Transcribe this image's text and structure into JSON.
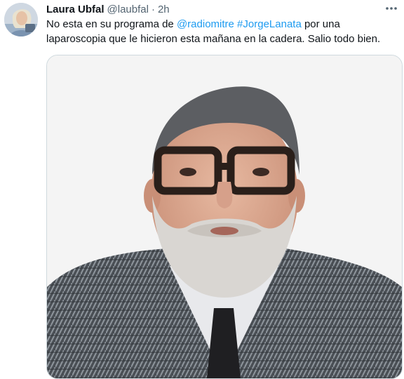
{
  "tweet": {
    "author": {
      "name": "Laura Ubfal",
      "handle": "@laubfal"
    },
    "separator": "·",
    "time": "2h",
    "more_icon": "more-horizontal-icon",
    "text_parts": [
      {
        "text": "No esta en su programa de ",
        "type": "text"
      },
      {
        "text": "@radiomitre",
        "type": "link"
      },
      {
        "text": " ",
        "type": "text"
      },
      {
        "text": "#JorgeLanata",
        "type": "link"
      },
      {
        "text": " por una laparoscopia que le hicieron esta mañana en la cadera. Salio todo bien.",
        "type": "text"
      }
    ]
  },
  "colors": {
    "text": "#0f1419",
    "secondary": "#536471",
    "link": "#1d9bf0",
    "border": "#cfd9de"
  }
}
